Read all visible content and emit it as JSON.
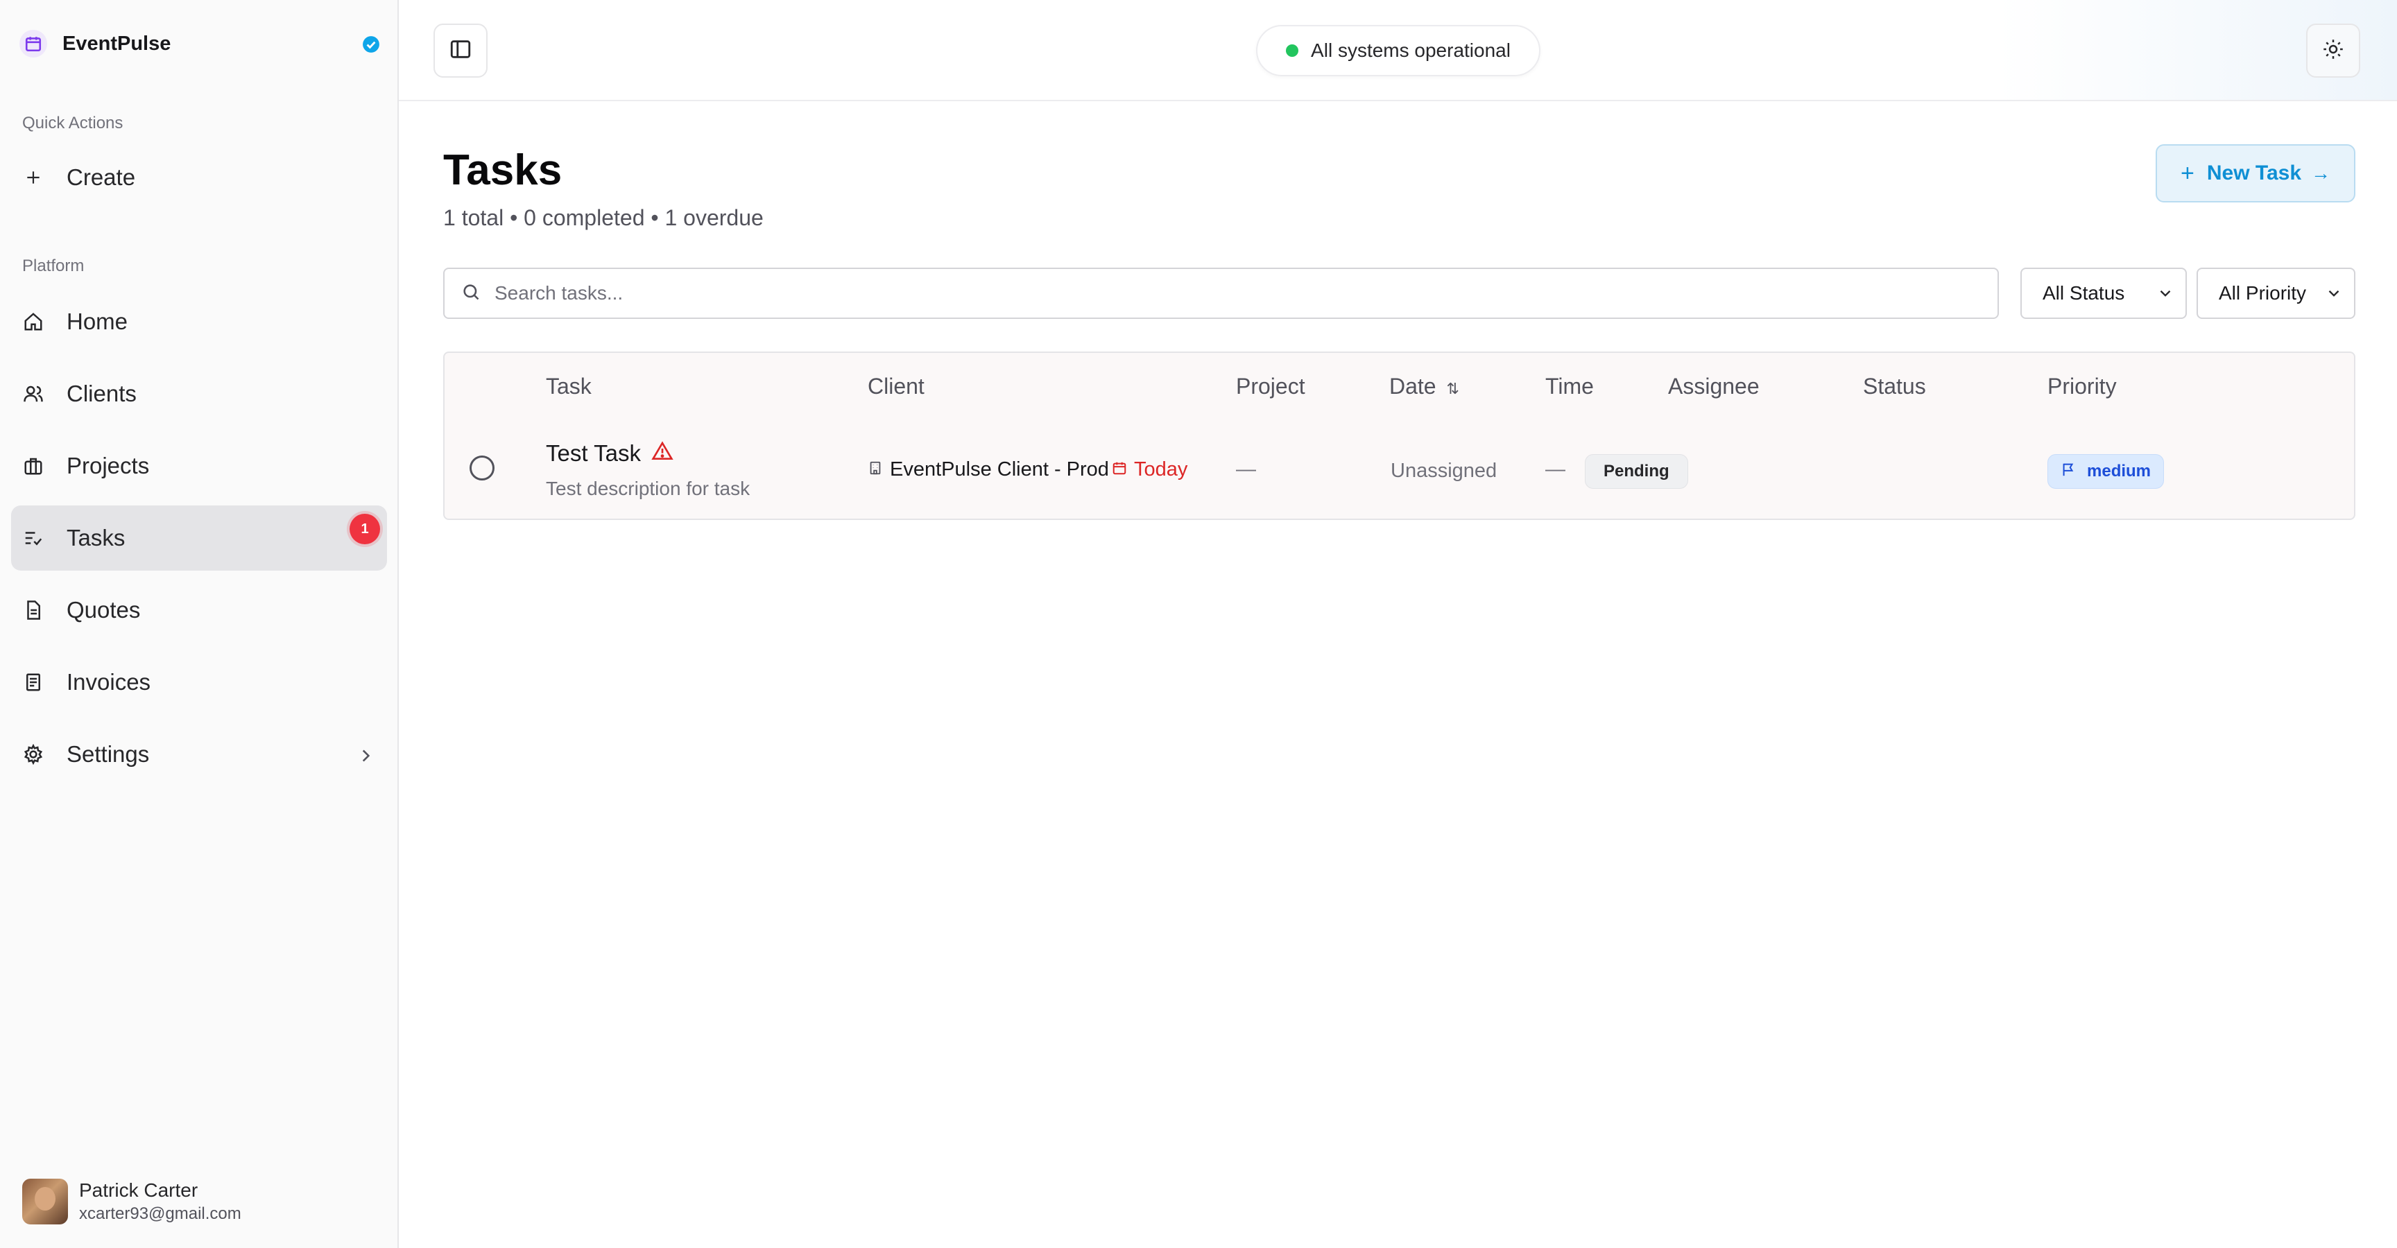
{
  "app": {
    "name": "EventPulse"
  },
  "sidebar": {
    "quick_actions_label": "Quick Actions",
    "create_label": "Create",
    "platform_label": "Platform",
    "items": [
      {
        "label": "Home",
        "icon": "home-icon"
      },
      {
        "label": "Clients",
        "icon": "users-icon"
      },
      {
        "label": "Projects",
        "icon": "briefcase-icon"
      },
      {
        "label": "Tasks",
        "icon": "list-check-icon",
        "active": true,
        "badge": "1"
      },
      {
        "label": "Quotes",
        "icon": "document-icon"
      },
      {
        "label": "Invoices",
        "icon": "receipt-icon"
      },
      {
        "label": "Settings",
        "icon": "gear-icon",
        "has_submenu": true
      }
    ]
  },
  "user": {
    "name": "Patrick Carter",
    "email": "xcarter93@gmail.com"
  },
  "topbar": {
    "status_text": "All systems operational",
    "status_color": "#22c55e"
  },
  "page": {
    "title": "Tasks",
    "subtitle": "1 total • 0 completed • 1 overdue",
    "new_task_label": "New Task"
  },
  "filters": {
    "search_placeholder": "Search tasks...",
    "status_value": "All Status",
    "priority_value": "All Priority"
  },
  "table": {
    "columns": [
      "Task",
      "Client",
      "Project",
      "Date",
      "Time",
      "Assignee",
      "Status",
      "Priority"
    ],
    "rows": [
      {
        "title": "Test Task",
        "description": "Test description for task",
        "client": "EventPulse Client - Prod",
        "project": "—",
        "date": "Today",
        "time": "—",
        "assignee": "Unassigned",
        "status": "Pending",
        "priority": "medium",
        "overdue": true
      }
    ]
  },
  "colors": {
    "accent": "#0f8fd4",
    "badge_red": "#ef3340",
    "overdue_red": "#dc2626",
    "priority_blue": "#1d4ed8"
  }
}
